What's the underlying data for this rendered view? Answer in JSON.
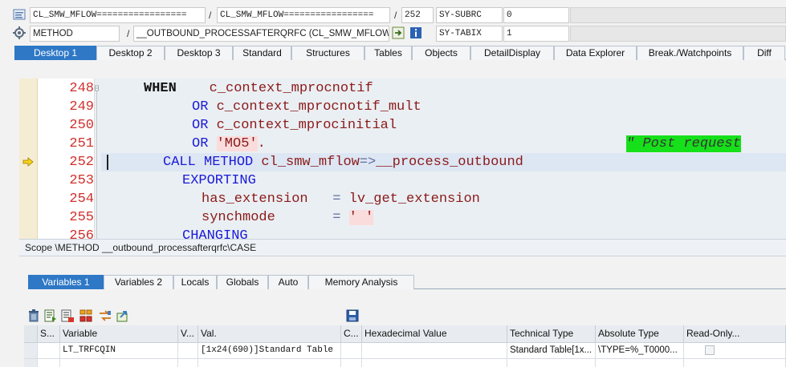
{
  "header": {
    "program1": "CL_SMW_MFLOW=================",
    "program2": "CL_SMW_MFLOW=================",
    "line_no": "252",
    "sysvar1_name": "SY-SUBRC",
    "sysvar1_value": "0",
    "event_type": "METHOD",
    "event_name": "__OUTBOUND_PROCESSAFTERQRFC (CL_SMW_MFLOW)",
    "sysvar2_name": "SY-TABIX",
    "sysvar2_value": "1",
    "slash": "/"
  },
  "desktop_tabs": [
    {
      "label": "Desktop 1",
      "active": true
    },
    {
      "label": "Desktop 2"
    },
    {
      "label": "Desktop 3"
    },
    {
      "label": "Standard"
    },
    {
      "label": "Structures"
    },
    {
      "label": "Tables"
    },
    {
      "label": "Objects"
    },
    {
      "label": "DetailDisplay"
    },
    {
      "label": "Data Explorer"
    },
    {
      "label": "Break./Watchpoints"
    },
    {
      "label": "Diff"
    }
  ],
  "code": {
    "line_numbers": [
      "248",
      "249",
      "250",
      "251",
      "252",
      "253",
      "254",
      "255",
      "256"
    ],
    "l248": {
      "kw": "WHEN",
      "id": "c_context_mprocnotif"
    },
    "l249": {
      "kw": "OR",
      "id": "c_context_mprocnotif_mult"
    },
    "l250": {
      "kw": "OR",
      "id": "c_context_mprocinitial"
    },
    "l251": {
      "kw": "OR",
      "str": "'MO5'",
      "dot": ".",
      "comment": "\" Post request"
    },
    "l252": {
      "kw": "CALL METHOD",
      "id": "cl_smw_mflow",
      "op": "=>",
      "id2": "__process_outbound"
    },
    "l253": {
      "kw": "EXPORTING"
    },
    "l254": {
      "id": "has_extension",
      "op": "=",
      "id2": "lv_get_extension"
    },
    "l255": {
      "id": "synchmode",
      "op": "=",
      "str": "' '"
    },
    "l256": {
      "kw": "CHANGING"
    }
  },
  "scope": "Scope \\METHOD __outbound_processafterqrfc\\CASE",
  "var_tabs": [
    {
      "label": "Variables 1",
      "active": true
    },
    {
      "label": "Variables 2"
    },
    {
      "label": "Locals"
    },
    {
      "label": "Globals"
    },
    {
      "label": "Auto"
    },
    {
      "label": "Memory Analysis"
    }
  ],
  "toolbar_icons": [
    "delete-icon",
    "detail-icon",
    "filter-icon",
    "tree-icon",
    "swap-icon",
    "export-icon",
    "save-icon"
  ],
  "grid": {
    "headers": [
      "S...",
      "Variable",
      "V...",
      "Val.",
      "C...",
      "Hexadecimal Value",
      "Technical Type",
      "Absolute Type",
      "Read-Only..."
    ],
    "row": {
      "variable": "LT_TRFCQIN",
      "value": "[1x24(690)]Standard Table",
      "technical_type": "Standard Table[1x...",
      "absolute_type": "\\TYPE=%_T0000..."
    }
  },
  "colors": {
    "tab_active": "#2e78c6",
    "keyword": "#1a1ad8",
    "identifier": "#8b1a1a",
    "line_number": "#d0302c",
    "comment_bg": "#16e01a"
  }
}
